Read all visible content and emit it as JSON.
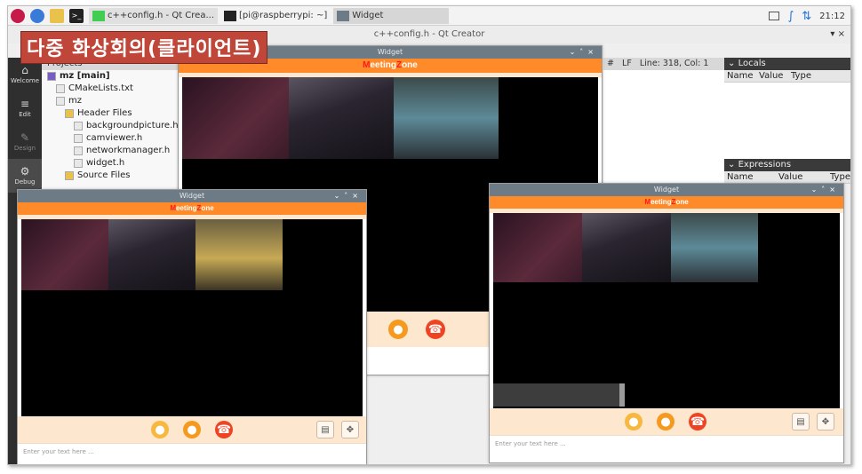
{
  "taskbar": {
    "tasks": [
      {
        "label": "c++config.h - Qt Crea..."
      },
      {
        "label": "[pi@raspberrypi: ~]"
      },
      {
        "label": "Widget"
      }
    ],
    "clock": "21:12"
  },
  "qt": {
    "title": "c++config.h - Qt Creator",
    "window_controls": "▾ ×"
  },
  "caption": "다중 화상회의(클라이언트)",
  "modebar": [
    {
      "label": "Welcome",
      "icon": "home-icon"
    },
    {
      "label": "Edit",
      "icon": "edit-icon"
    },
    {
      "label": "Design",
      "icon": "design-icon"
    },
    {
      "label": "Debug",
      "icon": "bug-icon"
    }
  ],
  "projects": {
    "header": "Projects",
    "tree": [
      {
        "label": "mz [main]",
        "bold": true,
        "indent": 0
      },
      {
        "label": "CMakeLists.txt",
        "indent": 1
      },
      {
        "label": "mz",
        "indent": 1
      },
      {
        "label": "Header Files",
        "indent": 2
      },
      {
        "label": "backgroundpicture.h",
        "indent": 3
      },
      {
        "label": "camviewer.h",
        "indent": 3
      },
      {
        "label": "networkmanager.h",
        "indent": 3
      },
      {
        "label": "widget.h",
        "indent": 3
      },
      {
        "label": "Source Files",
        "indent": 2
      }
    ]
  },
  "editor_status": {
    "hash": "#",
    "line_ending": "LF",
    "position": "Line: 318, Col: 1"
  },
  "debugger": {
    "locals_title": "Locals",
    "expressions_title": "Expressions",
    "columns": [
      "Name",
      "Value",
      "Type"
    ]
  },
  "widget_window": {
    "title": "Widget",
    "brand": {
      "m": "M",
      "rest1": "eeting",
      "z": "Z",
      "rest2": "one"
    },
    "input_placeholder": "Enter your text here ..."
  },
  "colors": {
    "accent_orange": "#ff8a2a",
    "brand_red": "#ff1a1a",
    "control_bg": "#fde7cf",
    "call_red": "#ef4423",
    "cam_orange": "#f59a1e",
    "title_bar": "#6d7b87"
  }
}
